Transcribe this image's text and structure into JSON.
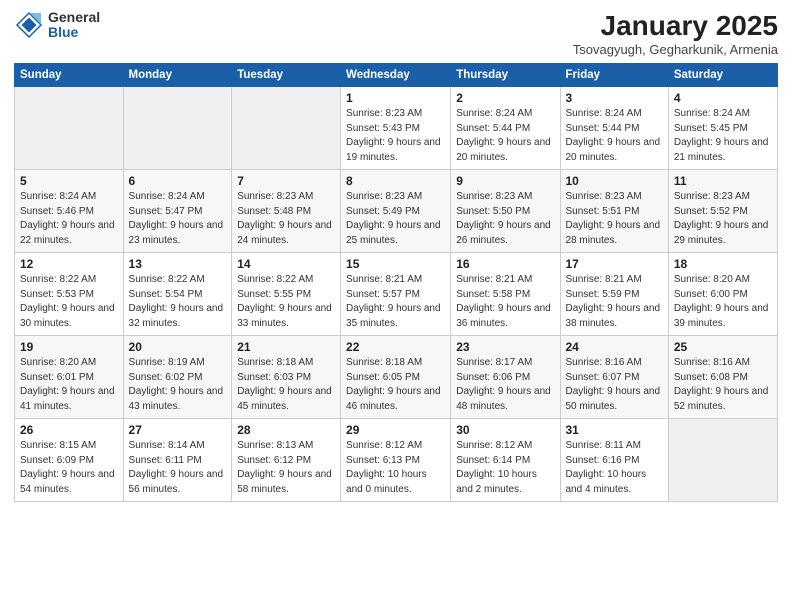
{
  "header": {
    "logo_general": "General",
    "logo_blue": "Blue",
    "title": "January 2025",
    "subtitle": "Tsovagyugh, Gegharkunik, Armenia"
  },
  "weekdays": [
    "Sunday",
    "Monday",
    "Tuesday",
    "Wednesday",
    "Thursday",
    "Friday",
    "Saturday"
  ],
  "weeks": [
    [
      {
        "day": "",
        "sunrise": "",
        "sunset": "",
        "daylight": ""
      },
      {
        "day": "",
        "sunrise": "",
        "sunset": "",
        "daylight": ""
      },
      {
        "day": "",
        "sunrise": "",
        "sunset": "",
        "daylight": ""
      },
      {
        "day": "1",
        "sunrise": "Sunrise: 8:23 AM",
        "sunset": "Sunset: 5:43 PM",
        "daylight": "Daylight: 9 hours and 19 minutes."
      },
      {
        "day": "2",
        "sunrise": "Sunrise: 8:24 AM",
        "sunset": "Sunset: 5:44 PM",
        "daylight": "Daylight: 9 hours and 20 minutes."
      },
      {
        "day": "3",
        "sunrise": "Sunrise: 8:24 AM",
        "sunset": "Sunset: 5:44 PM",
        "daylight": "Daylight: 9 hours and 20 minutes."
      },
      {
        "day": "4",
        "sunrise": "Sunrise: 8:24 AM",
        "sunset": "Sunset: 5:45 PM",
        "daylight": "Daylight: 9 hours and 21 minutes."
      }
    ],
    [
      {
        "day": "5",
        "sunrise": "Sunrise: 8:24 AM",
        "sunset": "Sunset: 5:46 PM",
        "daylight": "Daylight: 9 hours and 22 minutes."
      },
      {
        "day": "6",
        "sunrise": "Sunrise: 8:24 AM",
        "sunset": "Sunset: 5:47 PM",
        "daylight": "Daylight: 9 hours and 23 minutes."
      },
      {
        "day": "7",
        "sunrise": "Sunrise: 8:23 AM",
        "sunset": "Sunset: 5:48 PM",
        "daylight": "Daylight: 9 hours and 24 minutes."
      },
      {
        "day": "8",
        "sunrise": "Sunrise: 8:23 AM",
        "sunset": "Sunset: 5:49 PM",
        "daylight": "Daylight: 9 hours and 25 minutes."
      },
      {
        "day": "9",
        "sunrise": "Sunrise: 8:23 AM",
        "sunset": "Sunset: 5:50 PM",
        "daylight": "Daylight: 9 hours and 26 minutes."
      },
      {
        "day": "10",
        "sunrise": "Sunrise: 8:23 AM",
        "sunset": "Sunset: 5:51 PM",
        "daylight": "Daylight: 9 hours and 28 minutes."
      },
      {
        "day": "11",
        "sunrise": "Sunrise: 8:23 AM",
        "sunset": "Sunset: 5:52 PM",
        "daylight": "Daylight: 9 hours and 29 minutes."
      }
    ],
    [
      {
        "day": "12",
        "sunrise": "Sunrise: 8:22 AM",
        "sunset": "Sunset: 5:53 PM",
        "daylight": "Daylight: 9 hours and 30 minutes."
      },
      {
        "day": "13",
        "sunrise": "Sunrise: 8:22 AM",
        "sunset": "Sunset: 5:54 PM",
        "daylight": "Daylight: 9 hours and 32 minutes."
      },
      {
        "day": "14",
        "sunrise": "Sunrise: 8:22 AM",
        "sunset": "Sunset: 5:55 PM",
        "daylight": "Daylight: 9 hours and 33 minutes."
      },
      {
        "day": "15",
        "sunrise": "Sunrise: 8:21 AM",
        "sunset": "Sunset: 5:57 PM",
        "daylight": "Daylight: 9 hours and 35 minutes."
      },
      {
        "day": "16",
        "sunrise": "Sunrise: 8:21 AM",
        "sunset": "Sunset: 5:58 PM",
        "daylight": "Daylight: 9 hours and 36 minutes."
      },
      {
        "day": "17",
        "sunrise": "Sunrise: 8:21 AM",
        "sunset": "Sunset: 5:59 PM",
        "daylight": "Daylight: 9 hours and 38 minutes."
      },
      {
        "day": "18",
        "sunrise": "Sunrise: 8:20 AM",
        "sunset": "Sunset: 6:00 PM",
        "daylight": "Daylight: 9 hours and 39 minutes."
      }
    ],
    [
      {
        "day": "19",
        "sunrise": "Sunrise: 8:20 AM",
        "sunset": "Sunset: 6:01 PM",
        "daylight": "Daylight: 9 hours and 41 minutes."
      },
      {
        "day": "20",
        "sunrise": "Sunrise: 8:19 AM",
        "sunset": "Sunset: 6:02 PM",
        "daylight": "Daylight: 9 hours and 43 minutes."
      },
      {
        "day": "21",
        "sunrise": "Sunrise: 8:18 AM",
        "sunset": "Sunset: 6:03 PM",
        "daylight": "Daylight: 9 hours and 45 minutes."
      },
      {
        "day": "22",
        "sunrise": "Sunrise: 8:18 AM",
        "sunset": "Sunset: 6:05 PM",
        "daylight": "Daylight: 9 hours and 46 minutes."
      },
      {
        "day": "23",
        "sunrise": "Sunrise: 8:17 AM",
        "sunset": "Sunset: 6:06 PM",
        "daylight": "Daylight: 9 hours and 48 minutes."
      },
      {
        "day": "24",
        "sunrise": "Sunrise: 8:16 AM",
        "sunset": "Sunset: 6:07 PM",
        "daylight": "Daylight: 9 hours and 50 minutes."
      },
      {
        "day": "25",
        "sunrise": "Sunrise: 8:16 AM",
        "sunset": "Sunset: 6:08 PM",
        "daylight": "Daylight: 9 hours and 52 minutes."
      }
    ],
    [
      {
        "day": "26",
        "sunrise": "Sunrise: 8:15 AM",
        "sunset": "Sunset: 6:09 PM",
        "daylight": "Daylight: 9 hours and 54 minutes."
      },
      {
        "day": "27",
        "sunrise": "Sunrise: 8:14 AM",
        "sunset": "Sunset: 6:11 PM",
        "daylight": "Daylight: 9 hours and 56 minutes."
      },
      {
        "day": "28",
        "sunrise": "Sunrise: 8:13 AM",
        "sunset": "Sunset: 6:12 PM",
        "daylight": "Daylight: 9 hours and 58 minutes."
      },
      {
        "day": "29",
        "sunrise": "Sunrise: 8:12 AM",
        "sunset": "Sunset: 6:13 PM",
        "daylight": "Daylight: 10 hours and 0 minutes."
      },
      {
        "day": "30",
        "sunrise": "Sunrise: 8:12 AM",
        "sunset": "Sunset: 6:14 PM",
        "daylight": "Daylight: 10 hours and 2 minutes."
      },
      {
        "day": "31",
        "sunrise": "Sunrise: 8:11 AM",
        "sunset": "Sunset: 6:16 PM",
        "daylight": "Daylight: 10 hours and 4 minutes."
      },
      {
        "day": "",
        "sunrise": "",
        "sunset": "",
        "daylight": ""
      }
    ]
  ]
}
